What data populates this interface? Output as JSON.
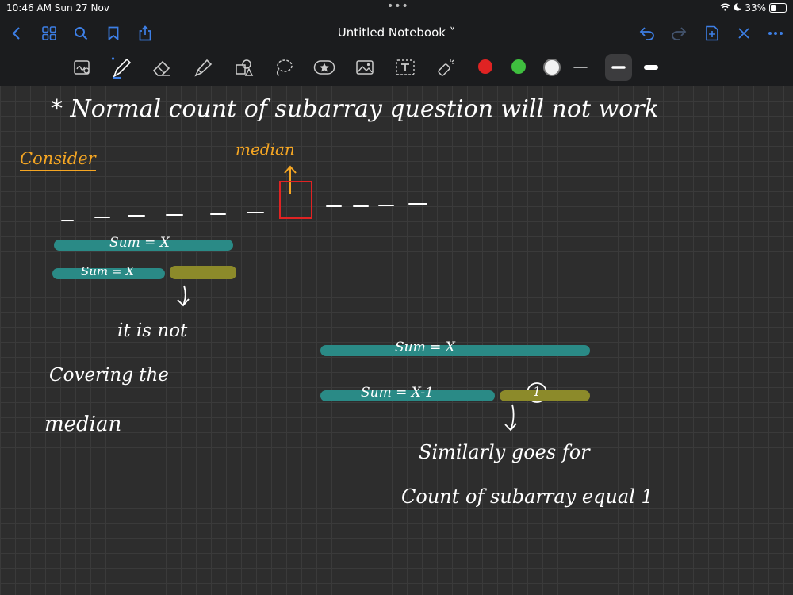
{
  "status": {
    "time": "10:46 AM  Sun 27 Nov",
    "battery": "33%"
  },
  "nav": {
    "title": "Untitled Notebook ˅"
  },
  "palette": {
    "red": "#e02323",
    "green": "#3fbf3f",
    "white": "#f2f2f2",
    "accent": "#3d7fe6"
  },
  "notes": {
    "heading": "* Normal count of subarray question will not work",
    "consider": "Consider",
    "median_label": "median",
    "sum_x_top": "Sum = X",
    "sum_x_short": "Sum = X",
    "not_covering_1": "it is not",
    "not_covering_2": "Covering the",
    "not_covering_3": "median",
    "sum_x_right": "Sum = X",
    "sum_x_minus": "Sum = X-1",
    "one_marker": "1",
    "similarly_1": "Similarly goes for",
    "similarly_2": "Count of subarray equal 1"
  }
}
